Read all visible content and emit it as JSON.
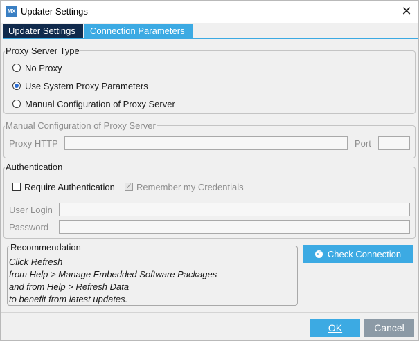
{
  "window": {
    "app_icon_text": "MX",
    "title": "Updater Settings",
    "close_glyph": "✕"
  },
  "tabs": [
    {
      "label": "Updater Settings",
      "active": false
    },
    {
      "label": "Connection Parameters",
      "active": true
    }
  ],
  "proxy_type": {
    "legend": "Proxy Server Type",
    "options": [
      {
        "label": "No Proxy",
        "selected": false
      },
      {
        "label": "Use System Proxy Parameters",
        "selected": true
      },
      {
        "label": "Manual Configuration of Proxy Server",
        "selected": false
      }
    ]
  },
  "manual_config": {
    "legend": "Manual Configuration of Proxy Server",
    "proxy_http_label": "Proxy HTTP",
    "proxy_http_value": "",
    "port_label": "Port",
    "port_value": ""
  },
  "authentication": {
    "legend": "Authentication",
    "require_label": "Require Authentication",
    "require_checked": false,
    "remember_label": "Remember my Credentials",
    "remember_checked": true,
    "user_login_label": "User Login",
    "user_login_value": "",
    "password_label": "Password",
    "password_value": ""
  },
  "recommendation": {
    "legend": "Recommendation",
    "lines": [
      "Click Refresh",
      "from Help > Manage Embedded Software Packages",
      "and from Help > Refresh Data",
      "to benefit from latest updates."
    ]
  },
  "buttons": {
    "check_connection": "Check Connection",
    "ok": "OK",
    "cancel": "Cancel"
  },
  "colors": {
    "accent": "#3caae3",
    "tab_dark": "#102a4c",
    "cancel_gray": "#8c9aa6"
  },
  "icons": {
    "app": "mx-app-icon",
    "close": "close-icon",
    "check_connection": "check-circle-icon"
  }
}
